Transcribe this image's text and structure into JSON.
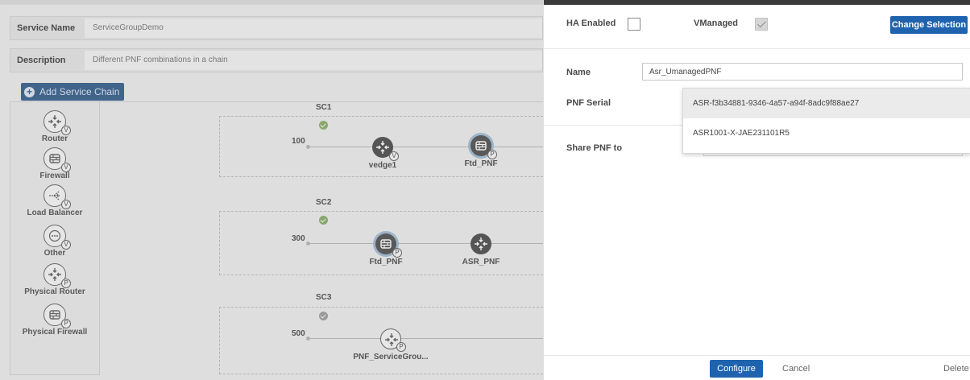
{
  "service": {
    "name_label": "Service Name",
    "name_value": "ServiceGroupDemo",
    "description_label": "Description",
    "description_value": "Different PNF combinations in a chain"
  },
  "add_chain_label": "Add Service Chain",
  "palette": [
    {
      "label": "Router",
      "icon": "router-icon",
      "badge": "V"
    },
    {
      "label": "Firewall",
      "icon": "firewall-icon",
      "badge": "V"
    },
    {
      "label": "Load Balancer",
      "icon": "load-balancer-icon",
      "badge": "V"
    },
    {
      "label": "Other",
      "icon": "other-icon",
      "badge": "V"
    },
    {
      "label": "Physical Router",
      "icon": "router-icon",
      "badge": "P"
    },
    {
      "label": "Physical Firewall",
      "icon": "firewall-icon",
      "badge": "P"
    }
  ],
  "chains": [
    {
      "name": "SC1",
      "bandwidth": "100",
      "status": "ok",
      "nodes": [
        {
          "label": "vedge1",
          "icon": "router-icon",
          "badge": "V"
        },
        {
          "label": "Ftd_PNF",
          "icon": "firewall-icon",
          "badge": "P"
        }
      ]
    },
    {
      "name": "SC2",
      "bandwidth": "300",
      "status": "ok",
      "nodes": [
        {
          "label": "Ftd_PNF",
          "icon": "firewall-icon",
          "badge": "P"
        },
        {
          "label": "ASR_PNF",
          "icon": "router-icon",
          "badge": ""
        }
      ]
    },
    {
      "name": "SC3",
      "bandwidth": "500",
      "status": "pending",
      "nodes": [
        {
          "label": "PNF_ServiceGrou...",
          "icon": "router-icon",
          "badge": "P"
        }
      ]
    }
  ],
  "panel": {
    "ha_label": "HA Enabled",
    "ha_checked": false,
    "vmanaged_label": "VManaged",
    "vmanaged_checked": true,
    "change_selection_label": "Change Selection",
    "name_label": "Name",
    "name_value": "Asr_UmanagedPNF",
    "serial_label": "PNF Serial",
    "serial_options": [
      "ASR-f3b34881-9346-4a57-a94f-8adc9f88ae27",
      "ASR1001-X-JAE231101R5"
    ],
    "share_label": "Share PNF to",
    "configure_label": "Configure",
    "cancel_label": "Cancel",
    "delete_label": "Delete"
  },
  "colors": {
    "primary": "#1f63ae",
    "add_button": "#41648b",
    "status_ok": "#8aa86d"
  }
}
